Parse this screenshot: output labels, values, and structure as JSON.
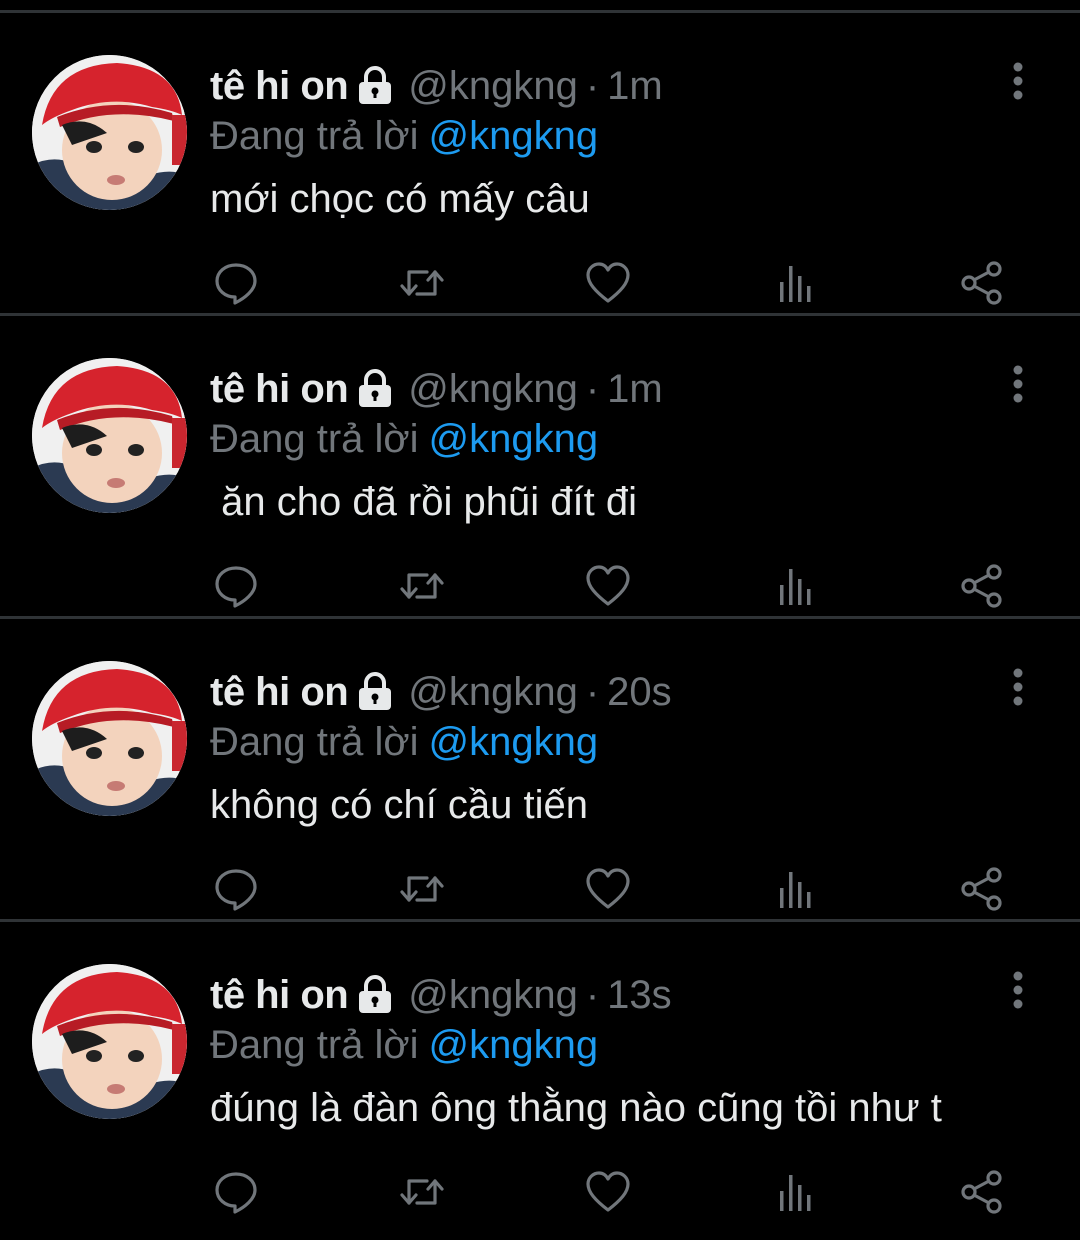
{
  "colors": {
    "background": "#000000",
    "divider": "#2f3336",
    "primary_text": "#e7e9ea",
    "secondary_text": "#71767b",
    "link": "#1d9bf0"
  },
  "icons": {
    "lock": "lock-icon",
    "more": "more-vertical-icon",
    "reply": "reply-icon",
    "retweet": "retweet-icon",
    "like": "heart-icon",
    "analytics": "analytics-icon",
    "share": "share-icon"
  },
  "tweets": [
    {
      "display_name": "tê hi on",
      "handle": "@kngkng",
      "separator": "·",
      "time": "1m",
      "reply_prefix": "Đang trả lời",
      "reply_to": "@kngkng",
      "text": "mới chọc có mấy câu"
    },
    {
      "display_name": "tê hi on",
      "handle": "@kngkng",
      "separator": "·",
      "time": "1m",
      "reply_prefix": "Đang trả lời",
      "reply_to": "@kngkng",
      "text": " ăn cho đã rồi phũi đít đi"
    },
    {
      "display_name": "tê hi on",
      "handle": "@kngkng",
      "separator": "·",
      "time": "20s",
      "reply_prefix": "Đang trả lời",
      "reply_to": "@kngkng",
      "text": "không có chí cầu tiến"
    },
    {
      "display_name": "tê hi on",
      "handle": "@kngkng",
      "separator": "·",
      "time": "13s",
      "reply_prefix": "Đang trả lời",
      "reply_to": "@kngkng",
      "text": "đúng là đàn ông thằng nào cũng tồi như t"
    }
  ]
}
